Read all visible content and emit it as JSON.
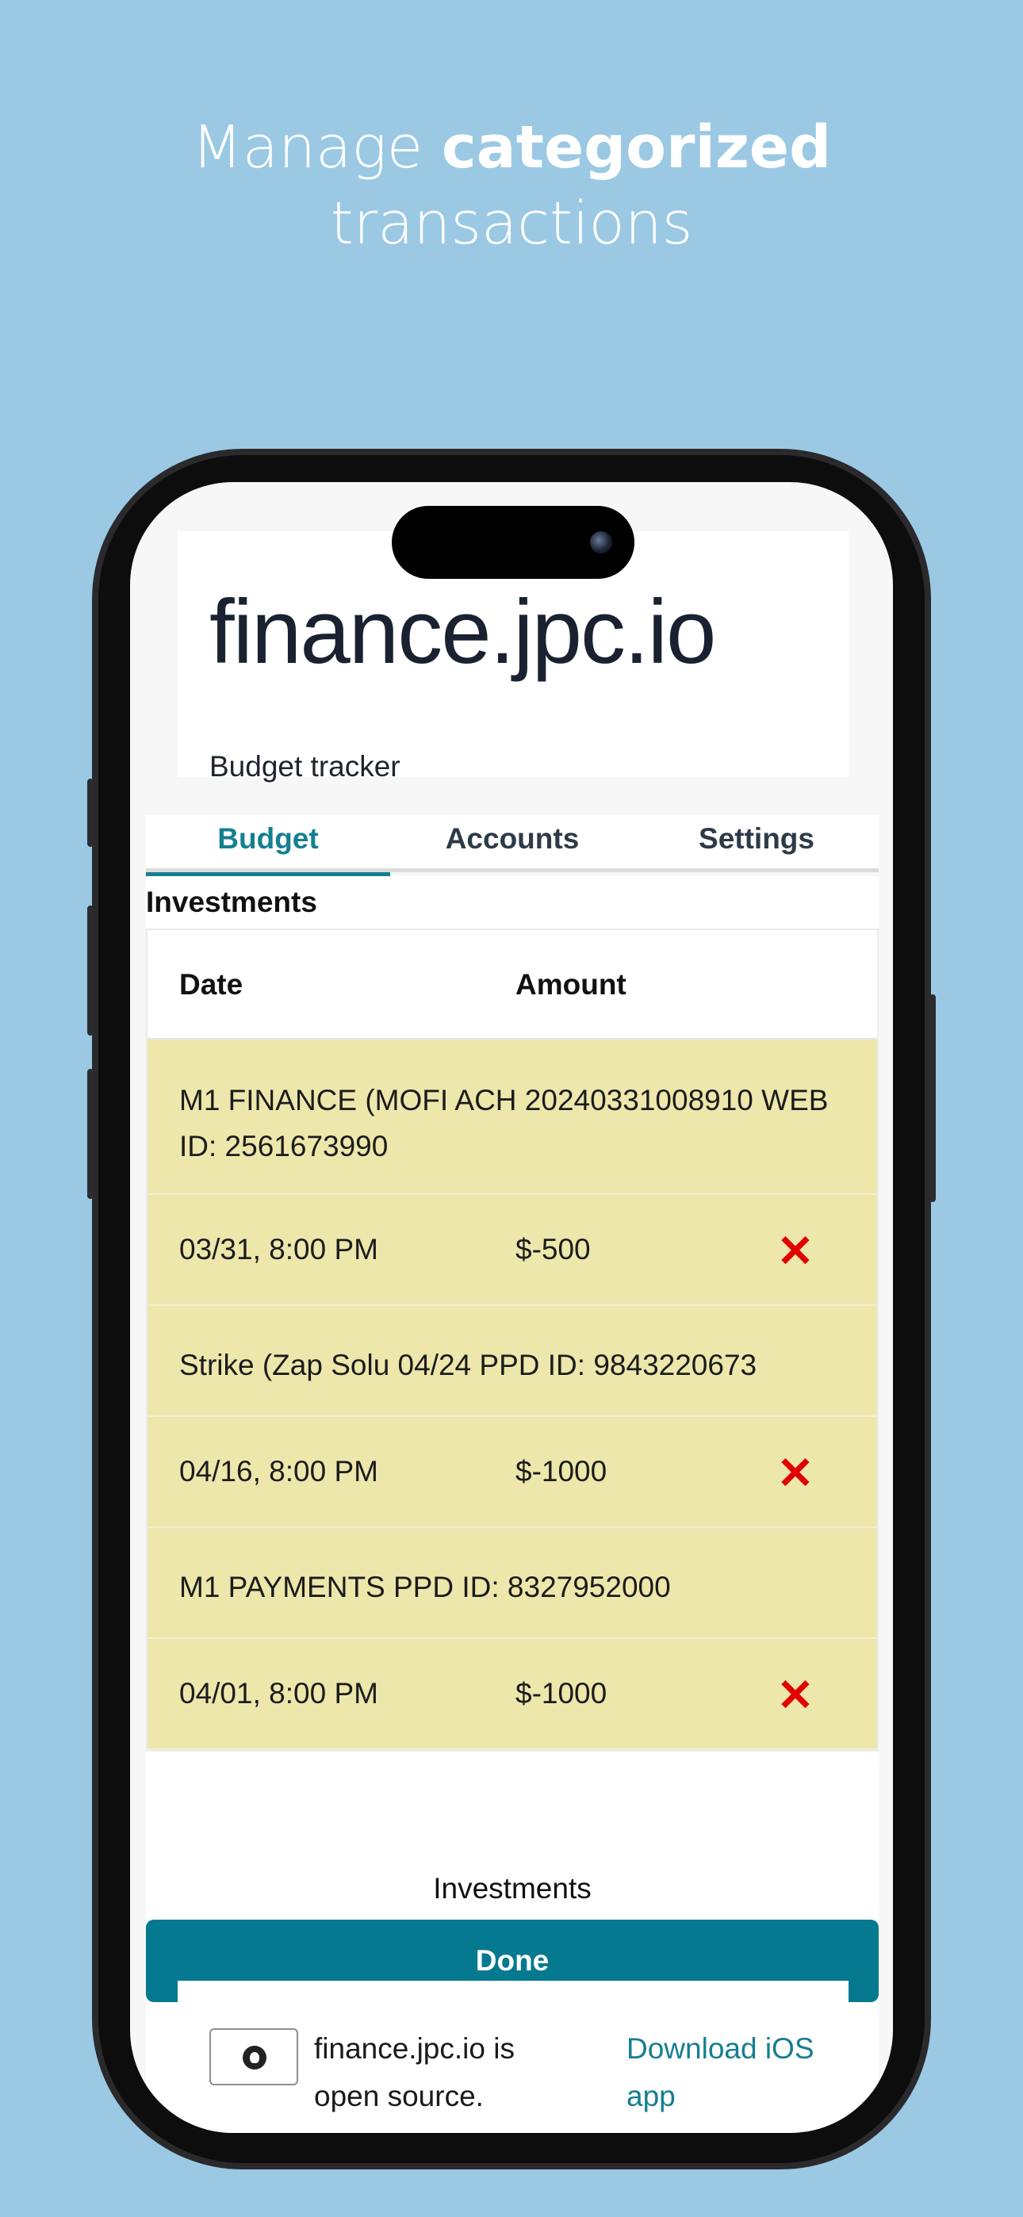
{
  "headline": {
    "prefix": "Manage",
    "bold": "categorized",
    "suffix": "transactions"
  },
  "app": {
    "title": "finance.jpc.io",
    "subtitle": "Budget tracker"
  },
  "tabs": [
    {
      "label": "Budget",
      "active": true
    },
    {
      "label": "Accounts",
      "active": false
    },
    {
      "label": "Settings",
      "active": false
    }
  ],
  "section": {
    "title": "Investments"
  },
  "table": {
    "headers": {
      "date": "Date",
      "amount": "Amount"
    },
    "transactions": [
      {
        "description": "M1 FINANCE (MOFI ACH 20240331008910 WEB ID: 2561673990",
        "date": "03/31, 8:00 PM",
        "amount": "$-500"
      },
      {
        "description": "Strike (Zap Solu 04/24 PPD ID: 9843220673",
        "date": "04/16, 8:00 PM",
        "amount": "$-1000"
      },
      {
        "description": "M1 PAYMENTS PPD ID: 8327952000",
        "date": "04/01, 8:00 PM",
        "amount": "$-1000"
      }
    ],
    "delete_glyph": "✕",
    "caption": "Investments"
  },
  "done_label": "Done",
  "footer": {
    "open_source_text": "finance.jpc.io is open source.",
    "download_link": "Download iOS app"
  },
  "colors": {
    "background": "#9bc9e4",
    "accent": "#157f92",
    "row_highlight": "#ede7ac",
    "button": "#04798f",
    "delete": "#e00000"
  },
  "icons": {
    "repo": "github-icon",
    "delete": "close-icon"
  }
}
